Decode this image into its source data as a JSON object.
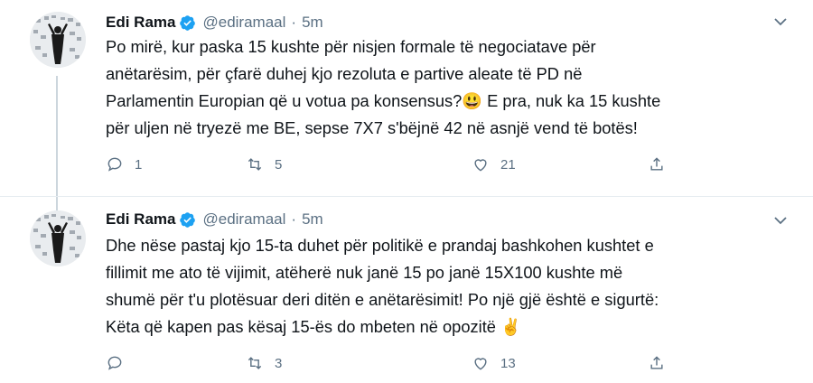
{
  "tweets": [
    {
      "author_name": "Edi Rama",
      "handle": "@ediramaal",
      "separator": "·",
      "time": "5m",
      "text_lines": [
        "Po mirë, kur paska 15 kushte për nisjen formale të negociatave për",
        "anëtarësim, për çfarë duhej kjo rezoluta e partive aleate të PD në",
        "Parlamentin Europian që u votua pa konsensus?😃  E pra, nuk ka 15 kushte",
        "për uljen në tryezë me BE, sepse 7X7 s'bëjnë 42 në asnjë vend të botës!"
      ],
      "replies": "1",
      "retweets": "5",
      "likes": "21"
    },
    {
      "author_name": "Edi Rama",
      "handle": "@ediramaal",
      "separator": "·",
      "time": "5m",
      "text_lines": [
        "Dhe nëse pastaj kjo 15-ta duhet për politikë e prandaj bashkohen kushtet e",
        "fillimit me ato të vijimit, atëherë nuk janë 15 po janë 15X100 kushte më",
        "shumë për t'u plotësuar deri ditën e anëtarësimit! Po një gjë është e sigurtë:",
        "Këta që kapen pas kësaj 15-ës do mbeten në opozitë ✌️"
      ],
      "replies": "",
      "retweets": "3",
      "likes": "13"
    }
  ],
  "colors": {
    "verified_blue": "#1da1f2",
    "muted": "#5b7083",
    "thread_line": "#ccd6dd"
  },
  "icons": [
    "verified-badge-icon",
    "chevron-down-icon",
    "reply-icon",
    "retweet-icon",
    "like-icon",
    "share-icon"
  ]
}
